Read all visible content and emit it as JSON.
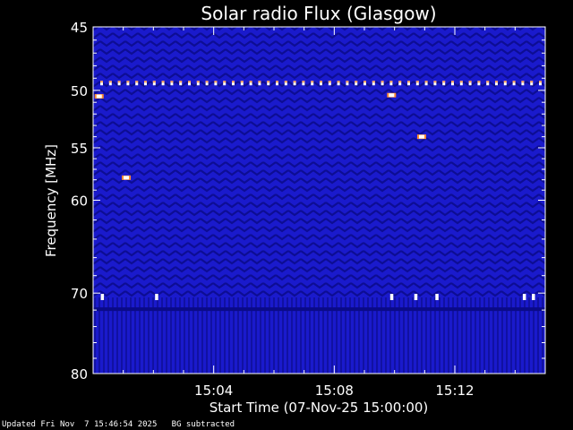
{
  "chart_data": {
    "type": "heatmap",
    "title": "Solar radio Flux (Glasgow)",
    "ylabel": "Frequency [MHz]",
    "xlabel": "Start Time (07-Nov-25 15:00:00)",
    "x_unit": "minutes after 15:00:00",
    "xlim": [
      0.0,
      15.0
    ],
    "ylim": [
      45,
      80
    ],
    "y_scale": "log",
    "y_ticks": [
      {
        "value": 45,
        "label": "45"
      },
      {
        "value": 50,
        "label": "50"
      },
      {
        "value": 55,
        "label": "55"
      },
      {
        "value": 60,
        "label": "60"
      },
      {
        "value": 70,
        "label": "70"
      },
      {
        "value": 80,
        "label": "80"
      }
    ],
    "x_ticks": [
      {
        "value": 4,
        "label": "15:04"
      },
      {
        "value": 8,
        "label": "15:08"
      },
      {
        "value": 12,
        "label": "15:12"
      }
    ],
    "features": {
      "interference_lines_mhz": [
        49.4,
        70.4
      ],
      "lower_band_start_mhz": 72,
      "bright_spots": [
        {
          "t": 1.1,
          "f": 57.8
        },
        {
          "t": 10.9,
          "f": 54.0
        },
        {
          "t": 0.2,
          "f": 50.5
        },
        {
          "t": 9.9,
          "f": 50.4
        }
      ]
    },
    "colors": {
      "background": "#1a1acc",
      "dark_stripe": "#0a0a88",
      "bright": "#ffffff",
      "hot": "#ff8a30"
    }
  },
  "footer": {
    "updated": "Updated Fri Nov  7 15:46:54 2025",
    "note": "BG subtracted"
  }
}
